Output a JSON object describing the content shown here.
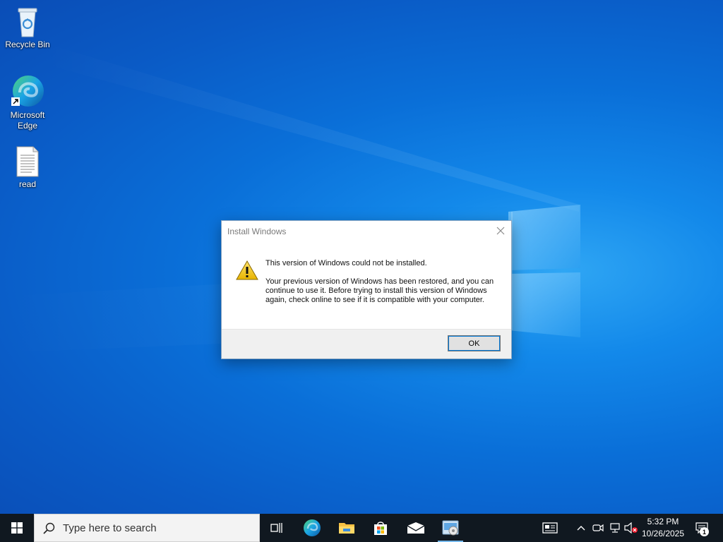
{
  "desktop": {
    "icons": [
      {
        "label": "Recycle Bin",
        "icon": "recycle-bin-icon"
      },
      {
        "label": "Microsoft Edge",
        "icon": "edge-icon"
      },
      {
        "label": "read",
        "icon": "text-document-icon"
      }
    ]
  },
  "dialog": {
    "title": "Install Windows",
    "headline": "This version of Windows could not be installed.",
    "message": "Your previous version of Windows has been restored, and you can continue to use it.  Before trying to install this version of Windows again, check online to see if it is compatible with your computer.",
    "ok_label": "OK",
    "icon": "warning-icon"
  },
  "taskbar": {
    "search_placeholder": "Type here to search",
    "apps": [
      "task-view-icon",
      "edge-icon",
      "file-explorer-icon",
      "store-icon",
      "mail-icon",
      "setup-icon"
    ],
    "tray": [
      "chevron-up-icon",
      "meet-now-icon",
      "network-icon",
      "volume-muted-icon"
    ],
    "time": "5:32 PM",
    "date": "10/26/2025",
    "notification_count": "1"
  },
  "colors": {
    "accent": "#0078d7",
    "taskbar": "#101820",
    "desktop": "#0a6fd8"
  }
}
